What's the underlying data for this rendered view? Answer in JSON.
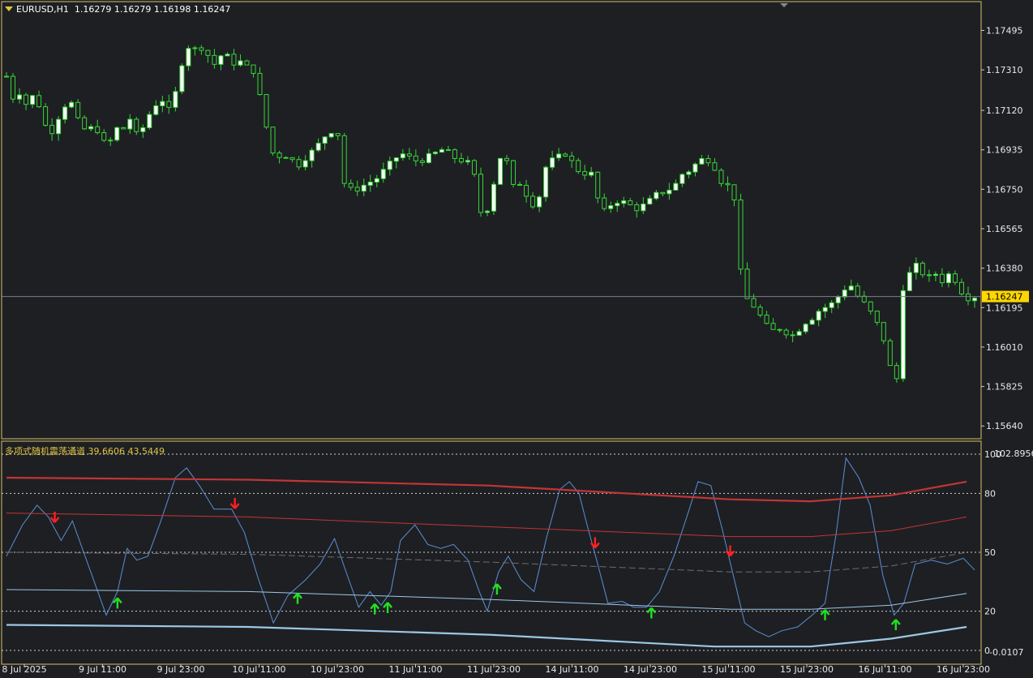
{
  "header": {
    "symbol": "EURUSD,H1",
    "ohlc": "1.16279 1.16279 1.16198 1.16247"
  },
  "indicator_header": {
    "name": "多项式随机震荡通道",
    "values": "39.6606 43.5449"
  },
  "colors": {
    "background": "#1e1f23",
    "frame": "#d8c26a",
    "bull_candle": "#ffffff",
    "bear_candle": "#1e1f23",
    "wick": "#37d637",
    "oscillator": "#5b8fd4",
    "red_channel": "#c23535",
    "lower_channel": "#9cc8e6",
    "up_arrow": "#22e022",
    "down_arrow": "#ff2020",
    "price_label_bg": "#ffd700"
  },
  "chart_data": [
    {
      "type": "candlestick",
      "title": "EURUSD,H1",
      "current_price": "1.16247",
      "ylim": [
        1.1558,
        1.1763
      ],
      "y_ticks": [
        "1.17495",
        "1.17310",
        "1.17120",
        "1.16935",
        "1.16750",
        "1.16565",
        "1.16380",
        "1.16195",
        "1.16010",
        "1.15825",
        "1.15640"
      ],
      "close_path": [
        [
          0,
          1.1728
        ],
        [
          8,
          1.1718
        ],
        [
          14,
          1.1722
        ],
        [
          24,
          1.1715
        ],
        [
          36,
          1.172
        ],
        [
          48,
          1.1705
        ],
        [
          56,
          1.1702
        ],
        [
          66,
          1.171
        ],
        [
          78,
          1.1718
        ],
        [
          90,
          1.1706
        ],
        [
          100,
          1.1702
        ],
        [
          110,
          1.1705
        ],
        [
          120,
          1.1698
        ],
        [
          126,
          1.1692
        ],
        [
          134,
          1.1706
        ],
        [
          142,
          1.17
        ],
        [
          152,
          1.171
        ],
        [
          160,
          1.17
        ],
        [
          170,
          1.1704
        ],
        [
          180,
          1.1712
        ],
        [
          192,
          1.1718
        ],
        [
          202,
          1.1712
        ],
        [
          212,
          1.1722
        ],
        [
          220,
          1.1738
        ],
        [
          228,
          1.1743
        ],
        [
          236,
          1.174
        ],
        [
          244,
          1.1742
        ],
        [
          252,
          1.1737
        ],
        [
          260,
          1.1733
        ],
        [
          270,
          1.174
        ],
        [
          280,
          1.1734
        ],
        [
          290,
          1.1735
        ],
        [
          300,
          1.1732
        ],
        [
          310,
          1.173
        ],
        [
          318,
          1.1712
        ],
        [
          326,
          1.17
        ],
        [
          334,
          1.1688
        ],
        [
          342,
          1.1692
        ],
        [
          352,
          1.169
        ],
        [
          362,
          1.1686
        ],
        [
          372,
          1.169
        ],
        [
          384,
          1.1694
        ],
        [
          396,
          1.17
        ],
        [
          406,
          1.1703
        ],
        [
          414,
          1.17
        ],
        [
          420,
          1.1678
        ],
        [
          430,
          1.1674
        ],
        [
          440,
          1.1676
        ],
        [
          450,
          1.1678
        ],
        [
          460,
          1.168
        ],
        [
          470,
          1.1684
        ],
        [
          480,
          1.1688
        ],
        [
          490,
          1.1692
        ],
        [
          500,
          1.169
        ],
        [
          512,
          1.1688
        ],
        [
          524,
          1.169
        ],
        [
          534,
          1.1692
        ],
        [
          544,
          1.1694
        ],
        [
          556,
          1.169
        ],
        [
          570,
          1.1688
        ],
        [
          580,
          1.1686
        ],
        [
          588,
          1.1664
        ],
        [
          598,
          1.1666
        ],
        [
          606,
          1.1678
        ],
        [
          614,
          1.169
        ],
        [
          622,
          1.1688
        ],
        [
          630,
          1.1676
        ],
        [
          640,
          1.1678
        ],
        [
          650,
          1.167
        ],
        [
          660,
          1.1666
        ],
        [
          668,
          1.1684
        ],
        [
          676,
          1.1688
        ],
        [
          686,
          1.169
        ],
        [
          696,
          1.1692
        ],
        [
          706,
          1.1686
        ],
        [
          716,
          1.1682
        ],
        [
          726,
          1.1684
        ],
        [
          734,
          1.1672
        ],
        [
          742,
          1.1664
        ],
        [
          752,
          1.1668
        ],
        [
          762,
          1.167
        ],
        [
          772,
          1.1668
        ],
        [
          784,
          1.1666
        ],
        [
          796,
          1.1668
        ],
        [
          806,
          1.1672
        ],
        [
          818,
          1.1674
        ],
        [
          830,
          1.1676
        ],
        [
          840,
          1.1682
        ],
        [
          850,
          1.1684
        ],
        [
          860,
          1.1688
        ],
        [
          870,
          1.169
        ],
        [
          880,
          1.1686
        ],
        [
          890,
          1.1678
        ],
        [
          900,
          1.1676
        ],
        [
          906,
          1.167
        ],
        [
          912,
          1.1638
        ],
        [
          920,
          1.1624
        ],
        [
          930,
          1.162
        ],
        [
          940,
          1.1614
        ],
        [
          950,
          1.1608
        ],
        [
          960,
          1.161
        ],
        [
          970,
          1.1608
        ],
        [
          980,
          1.1606
        ],
        [
          990,
          1.1612
        ],
        [
          1000,
          1.1614
        ],
        [
          1010,
          1.1618
        ],
        [
          1020,
          1.162
        ],
        [
          1030,
          1.1622
        ],
        [
          1040,
          1.1628
        ],
        [
          1050,
          1.163
        ],
        [
          1060,
          1.1624
        ],
        [
          1070,
          1.162
        ],
        [
          1080,
          1.1614
        ],
        [
          1090,
          1.1606
        ],
        [
          1100,
          1.159
        ],
        [
          1106,
          1.158
        ],
        [
          1114,
          1.1628
        ],
        [
          1124,
          1.1636
        ],
        [
          1134,
          1.164
        ],
        [
          1144,
          1.1632
        ],
        [
          1154,
          1.1636
        ],
        [
          1164,
          1.1632
        ],
        [
          1174,
          1.1636
        ],
        [
          1184,
          1.163
        ],
        [
          1192,
          1.1624
        ],
        [
          1204,
          1.16247
        ]
      ]
    },
    {
      "type": "line",
      "title": "多项式随机震荡通道",
      "values_label": "39.6606 43.5449",
      "ylim": [
        0,
        100
      ],
      "y_ticks": [
        0,
        20,
        50,
        80,
        100
      ],
      "top_label": "102.8956",
      "bottom_label": "-0.0107",
      "x_ticks": [
        "8 Jul 2025",
        "9 Jul 11:00",
        "9 Jul 23:00",
        "10 Jul 11:00",
        "10 Jul 23:00",
        "11 Jul 11:00",
        "11 Jul 23:00",
        "14 Jul 11:00",
        "14 Jul 23:00",
        "15 Jul 11:00",
        "15 Jul 23:00",
        "16 Jul 11:00",
        "16 Jul 23:00"
      ],
      "series": [
        {
          "name": "oscillator",
          "points": [
            [
              0,
              48
            ],
            [
              20,
              64
            ],
            [
              38,
              74
            ],
            [
              52,
              68
            ],
            [
              68,
              56
            ],
            [
              82,
              66
            ],
            [
              96,
              50
            ],
            [
              110,
              34
            ],
            [
              124,
              18
            ],
            [
              138,
              30
            ],
            [
              150,
              52
            ],
            [
              162,
              46
            ],
            [
              176,
              48
            ],
            [
              192,
              66
            ],
            [
              210,
              88
            ],
            [
              224,
              93
            ],
            [
              240,
              84
            ],
            [
              258,
              72
            ],
            [
              280,
              72
            ],
            [
              296,
              60
            ],
            [
              312,
              38
            ],
            [
              332,
              14
            ],
            [
              350,
              28
            ],
            [
              372,
              36
            ],
            [
              390,
              44
            ],
            [
              408,
              57
            ],
            [
              424,
              38
            ],
            [
              438,
              22
            ],
            [
              452,
              30
            ],
            [
              466,
              23
            ],
            [
              478,
              30
            ],
            [
              490,
              56
            ],
            [
              508,
              64
            ],
            [
              524,
              54
            ],
            [
              540,
              52
            ],
            [
              556,
              54
            ],
            [
              574,
              46
            ],
            [
              588,
              30
            ],
            [
              598,
              20
            ],
            [
              612,
              40
            ],
            [
              624,
              48
            ],
            [
              640,
              36
            ],
            [
              656,
              30
            ],
            [
              672,
              58
            ],
            [
              688,
              82
            ],
            [
              700,
              86
            ],
            [
              712,
              80
            ],
            [
              722,
              64
            ],
            [
              734,
              46
            ],
            [
              748,
              24
            ],
            [
              766,
              25
            ],
            [
              780,
              22
            ],
            [
              796,
              22
            ],
            [
              812,
              30
            ],
            [
              830,
              48
            ],
            [
              846,
              68
            ],
            [
              860,
              86
            ],
            [
              876,
              84
            ],
            [
              890,
              62
            ],
            [
              904,
              38
            ],
            [
              918,
              14
            ],
            [
              932,
              10
            ],
            [
              948,
              7
            ],
            [
              964,
              10
            ],
            [
              984,
              12
            ],
            [
              1002,
              18
            ],
            [
              1018,
              24
            ],
            [
              1032,
              60
            ],
            [
              1044,
              98
            ],
            [
              1060,
              88
            ],
            [
              1074,
              74
            ],
            [
              1090,
              38
            ],
            [
              1104,
              18
            ],
            [
              1116,
              24
            ],
            [
              1130,
              44
            ],
            [
              1150,
              46
            ],
            [
              1170,
              44
            ],
            [
              1190,
              47
            ],
            [
              1204,
              41
            ]
          ]
        },
        {
          "name": "upper",
          "points": [
            [
              0,
              88
            ],
            [
              300,
              87
            ],
            [
              600,
              84
            ],
            [
              900,
              77
            ],
            [
              1000,
              76
            ],
            [
              1100,
              79
            ],
            [
              1194,
              86
            ]
          ]
        },
        {
          "name": "upper_inner",
          "points": [
            [
              0,
              70
            ],
            [
              300,
              68
            ],
            [
              600,
              63
            ],
            [
              900,
              58
            ],
            [
              1000,
              58
            ],
            [
              1100,
              61
            ],
            [
              1194,
              68
            ]
          ]
        },
        {
          "name": "middle",
          "points": [
            [
              0,
              50
            ],
            [
              300,
              49
            ],
            [
              600,
              45
            ],
            [
              900,
              40
            ],
            [
              1000,
              40
            ],
            [
              1100,
              43
            ],
            [
              1194,
              50
            ]
          ]
        },
        {
          "name": "lower_inner",
          "points": [
            [
              0,
              31
            ],
            [
              300,
              30
            ],
            [
              600,
              26
            ],
            [
              900,
              21
            ],
            [
              1000,
              21
            ],
            [
              1100,
              23
            ],
            [
              1194,
              29
            ]
          ]
        },
        {
          "name": "lower",
          "points": [
            [
              0,
              13
            ],
            [
              300,
              12
            ],
            [
              600,
              8
            ],
            [
              880,
              2
            ],
            [
              1000,
              2
            ],
            [
              1100,
              6
            ],
            [
              1194,
              12
            ]
          ]
        }
      ],
      "up_arrows": [
        138,
        362,
        458,
        474,
        610,
        802,
        1018,
        1106
      ],
      "down_arrows": [
        60,
        284,
        732,
        900
      ]
    }
  ]
}
